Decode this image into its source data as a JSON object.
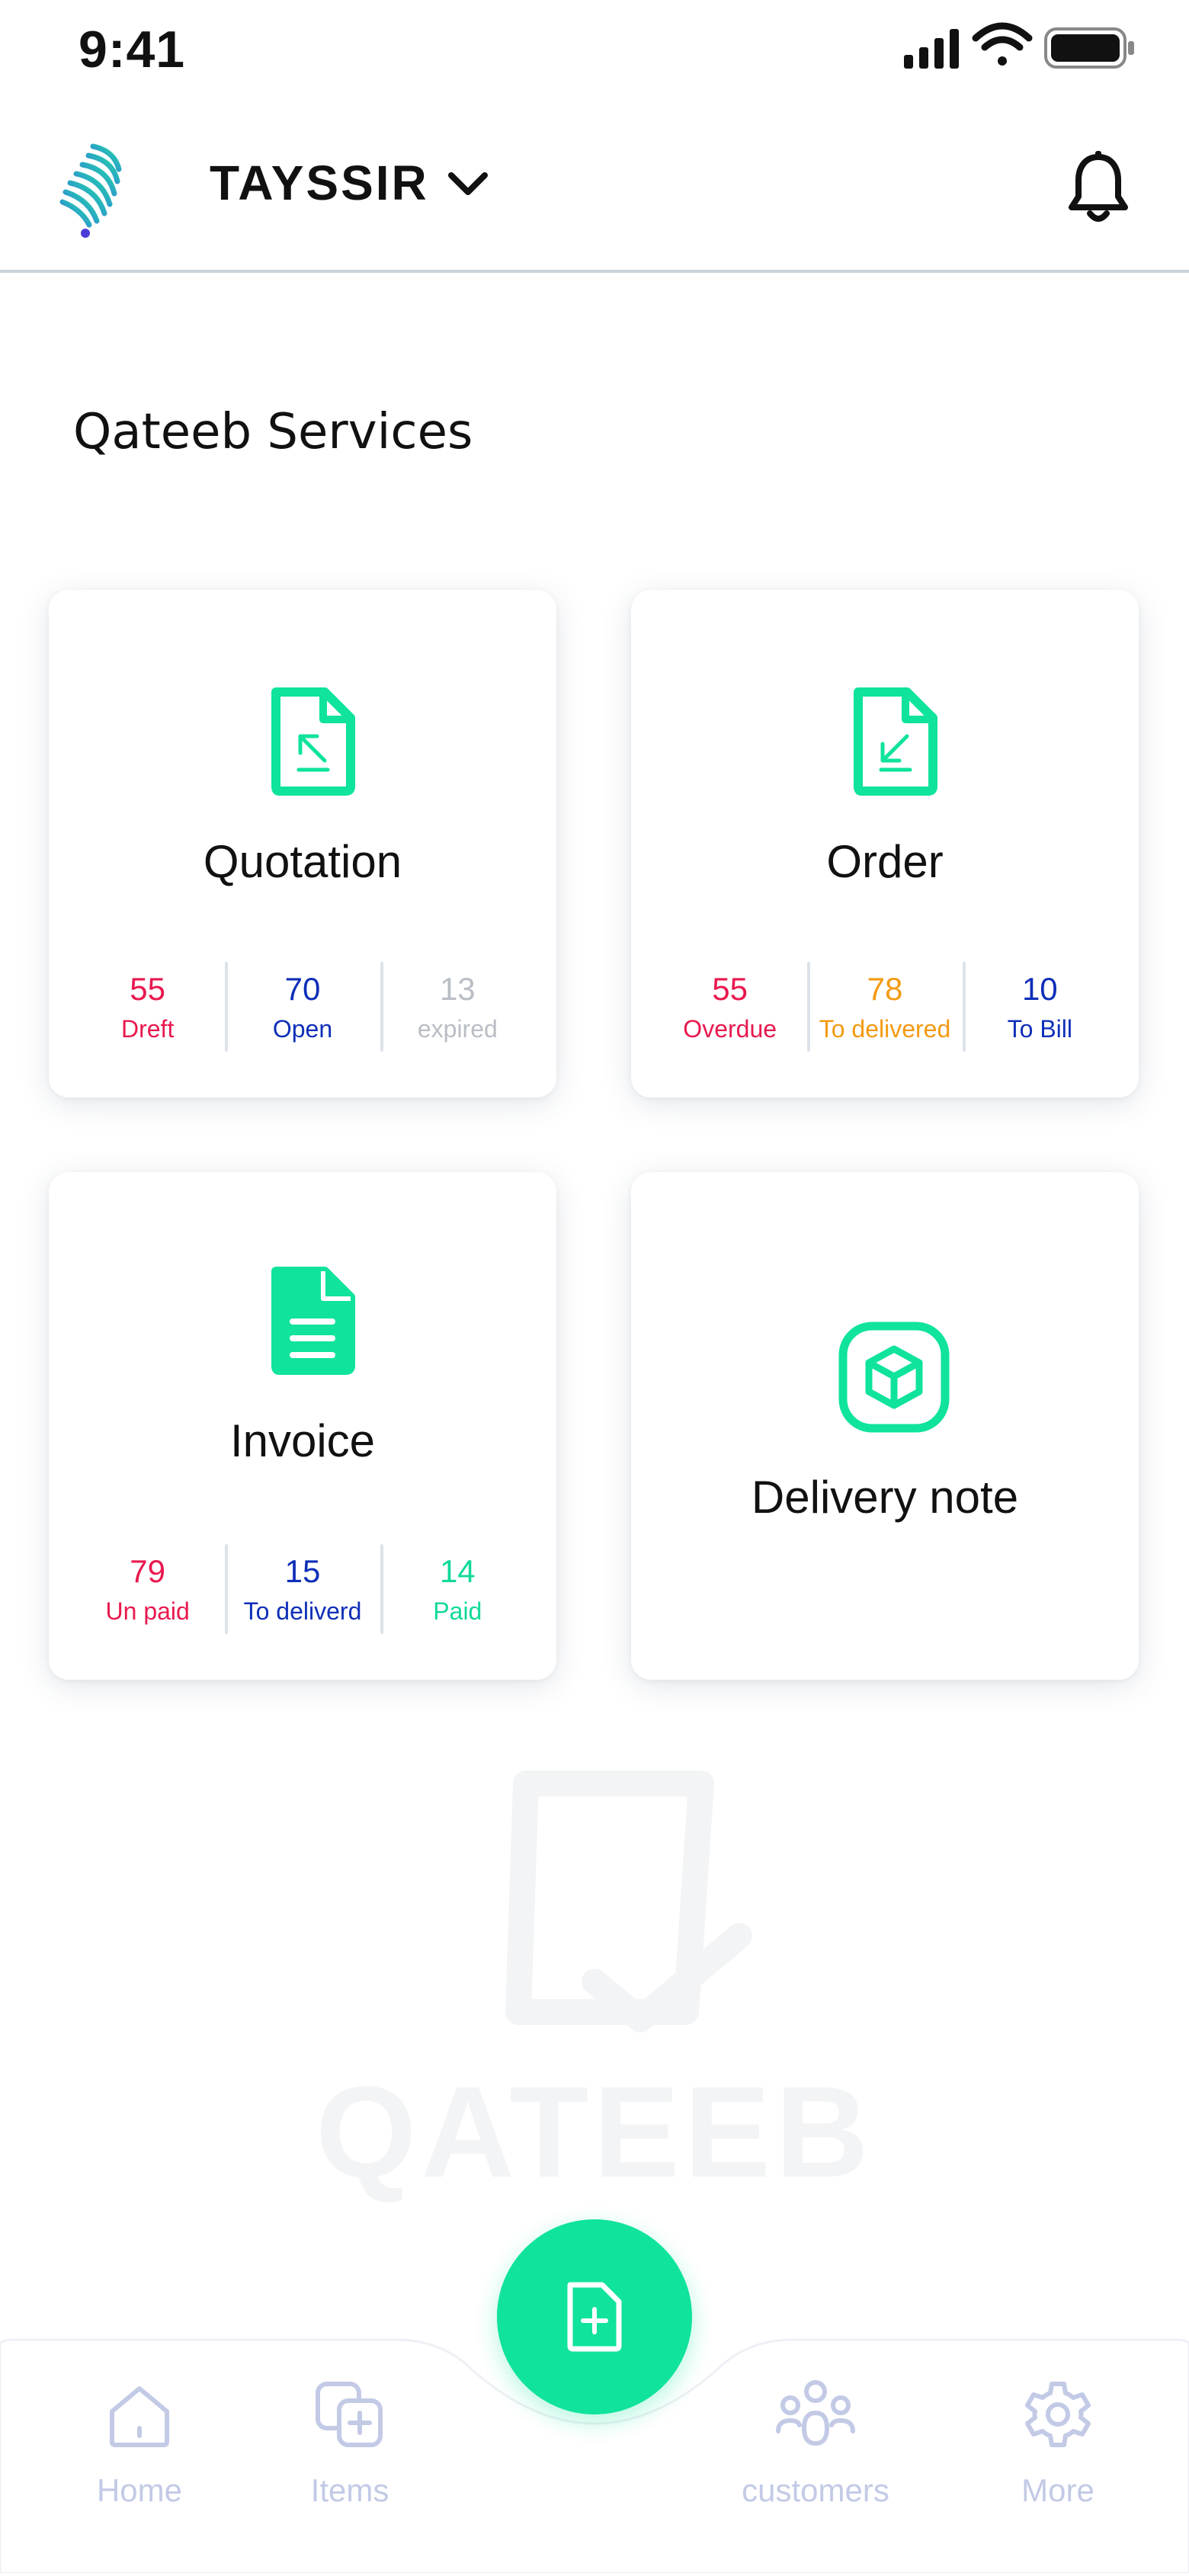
{
  "status_bar": {
    "time": "9:41"
  },
  "header": {
    "brand": "TAYSSIR"
  },
  "section_title": "Qateeb Services",
  "cards": {
    "quotation": {
      "title": "Quotation",
      "stats": [
        {
          "value": "55",
          "label": "Dreft",
          "color": "#e8194f"
        },
        {
          "value": "70",
          "label": "Open",
          "color": "#0f2fb8"
        },
        {
          "value": "13",
          "label": "expired",
          "color": "#b9bec5"
        }
      ]
    },
    "order": {
      "title": "Order",
      "stats": [
        {
          "value": "55",
          "label": "Overdue",
          "color": "#e8194f"
        },
        {
          "value": "78",
          "label": "To delivered",
          "color": "#f39a12"
        },
        {
          "value": "10",
          "label": "To Bill",
          "color": "#0f2fb8"
        }
      ]
    },
    "invoice": {
      "title": "Invoice",
      "stats": [
        {
          "value": "79",
          "label": "Un paid",
          "color": "#e8194f"
        },
        {
          "value": "15",
          "label": "To deliverd",
          "color": "#0f2fb8"
        },
        {
          "value": "14",
          "label": "Paid",
          "color": "#10d99a"
        }
      ]
    },
    "delivery_note": {
      "title": "Delivery note"
    }
  },
  "watermark": {
    "text": "QATEEB"
  },
  "bottom_nav": {
    "home": "Home",
    "items": "Items",
    "customers": "customers",
    "more": "More"
  },
  "colors": {
    "accent": "#0fe39c",
    "nav_inactive": "#c3cae6",
    "red": "#e8194f",
    "blue": "#0f2fb8",
    "orange": "#f39a12",
    "gray": "#b9bec5"
  }
}
